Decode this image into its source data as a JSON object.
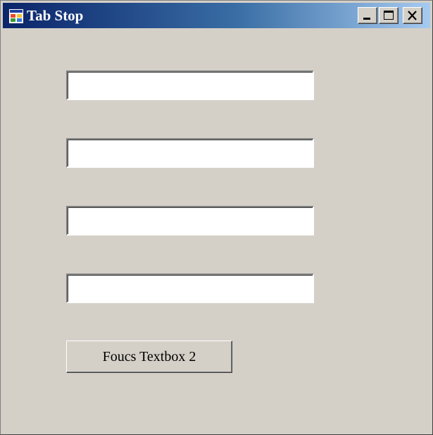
{
  "window": {
    "title": "Tab Stop",
    "icon": "app-window-icon",
    "controls": [
      "minimize-icon",
      "maximize-icon",
      "close-icon"
    ]
  },
  "form": {
    "textboxes": [
      "",
      "",
      "",
      ""
    ],
    "button_label": "Foucs Textbox 2"
  },
  "colors": {
    "face": "#d4d0c8",
    "titlebar_start": "#0a246a",
    "titlebar_end": "#a6caf0",
    "title_text": "#ffffff"
  }
}
